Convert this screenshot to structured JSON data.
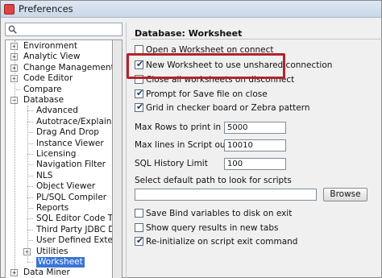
{
  "window": {
    "title": "Preferences"
  },
  "search": {
    "value": ""
  },
  "tree": {
    "items": [
      {
        "label": "Environment",
        "level": 0,
        "expander": "+"
      },
      {
        "label": "Analytic View",
        "level": 0,
        "expander": "+"
      },
      {
        "label": "Change Management Parar",
        "level": 0,
        "expander": "+"
      },
      {
        "label": "Code Editor",
        "level": 0,
        "expander": "+"
      },
      {
        "label": "Compare",
        "level": 0,
        "expander": ""
      },
      {
        "label": "Database",
        "level": 0,
        "expander": "−"
      },
      {
        "label": "Advanced",
        "level": 1,
        "expander": ""
      },
      {
        "label": "Autotrace/Explain Plan",
        "level": 1,
        "expander": ""
      },
      {
        "label": "Drag And Drop",
        "level": 1,
        "expander": ""
      },
      {
        "label": "Instance Viewer",
        "level": 1,
        "expander": ""
      },
      {
        "label": "Licensing",
        "level": 1,
        "expander": ""
      },
      {
        "label": "Navigation Filter",
        "level": 1,
        "expander": ""
      },
      {
        "label": "NLS",
        "level": 1,
        "expander": ""
      },
      {
        "label": "Object Viewer",
        "level": 1,
        "expander": ""
      },
      {
        "label": "PL/SQL Compiler",
        "level": 1,
        "expander": ""
      },
      {
        "label": "Reports",
        "level": 1,
        "expander": ""
      },
      {
        "label": "SQL Editor Code Templa",
        "level": 1,
        "expander": ""
      },
      {
        "label": "Third Party JDBC Driver",
        "level": 1,
        "expander": ""
      },
      {
        "label": "User Defined Extension",
        "level": 1,
        "expander": ""
      },
      {
        "label": "Utilities",
        "level": 1,
        "expander": "+"
      },
      {
        "label": "Worksheet",
        "level": 1,
        "expander": "",
        "selected": true
      },
      {
        "label": "Data Miner",
        "level": 0,
        "expander": "+"
      }
    ]
  },
  "panel": {
    "title": "Database: Worksheet",
    "checkboxes_top": [
      {
        "label": "Open a Worksheet on connect",
        "checked": false
      },
      {
        "label": "New Worksheet to use unshared connection",
        "checked": true,
        "highlighted": true
      },
      {
        "label": "Close all worksheets on disconnect",
        "checked": false
      },
      {
        "label": "Prompt for Save file on close",
        "checked": true
      },
      {
        "label": "Grid in checker board or Zebra pattern",
        "checked": true
      }
    ],
    "fields": [
      {
        "label": "Max Rows to print in a script",
        "value": "5000"
      },
      {
        "label": "Max lines in Script output",
        "value": "10010"
      },
      {
        "label": "SQL History Limit",
        "value": "100"
      }
    ],
    "path_label": "Select default path to look for scripts",
    "path_value": "",
    "browse_label": "Browse",
    "checkboxes_bottom": [
      {
        "label": "Save Bind variables to disk on exit",
        "checked": false
      },
      {
        "label": "Show query results in new tabs",
        "checked": false
      },
      {
        "label": "Re-initialize on script exit command",
        "checked": true
      }
    ],
    "highlight_color": "#b2242b"
  }
}
